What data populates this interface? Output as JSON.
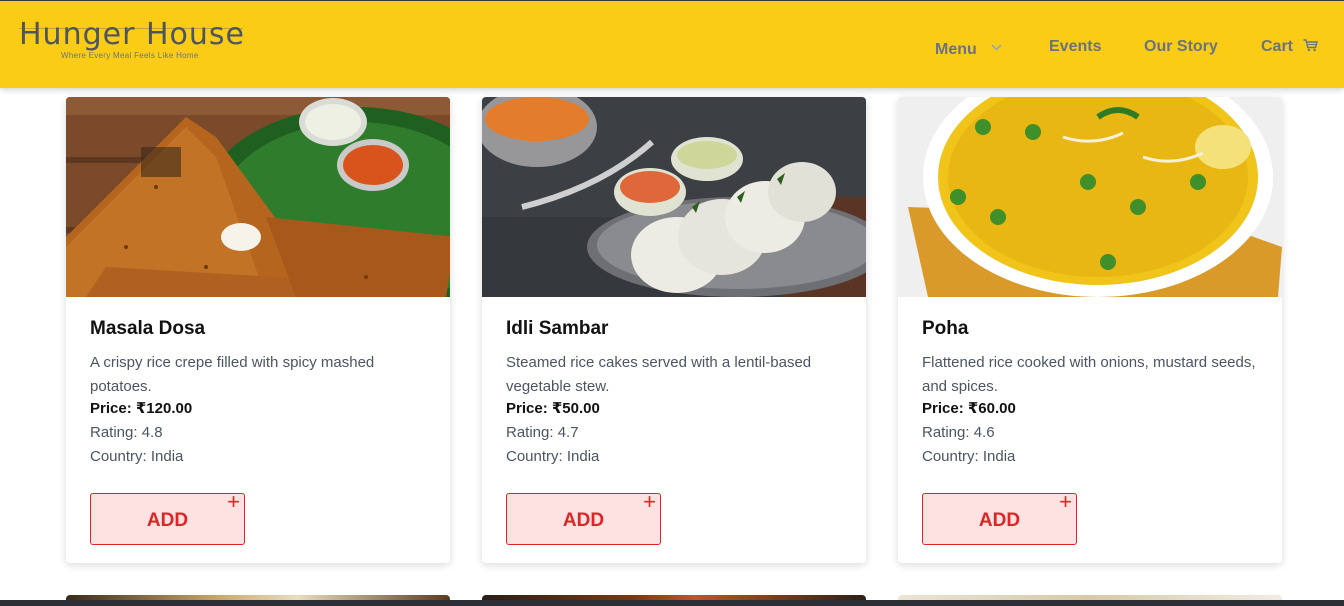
{
  "brand": {
    "name": "Hunger House",
    "tagline": "Where Every Meal Feels Like Home"
  },
  "nav": {
    "menu": "Menu",
    "events": "Events",
    "story": "Our Story",
    "cart": "Cart"
  },
  "icons": {
    "menu_chevron": "chevron-down-icon",
    "cart": "shopping-cart-icon",
    "add": "plus-icon"
  },
  "colors": {
    "navbar_bg": "#facc15",
    "nav_text": "#6b7280",
    "add_border": "#dc2626",
    "add_bg": "#fee2e2"
  },
  "items": [
    {
      "name": "Masala Dosa",
      "description": "A crispy rice crepe filled with spicy mashed potatoes.",
      "price": "Price: ₹120.00",
      "rating": "Rating: 4.8",
      "country": "Country: India",
      "button": "ADD",
      "plus": "+"
    },
    {
      "name": "Idli Sambar",
      "description": "Steamed rice cakes served with a lentil-based vegetable stew.",
      "price": "Price: ₹50.00",
      "rating": "Rating: 4.7",
      "country": "Country: India",
      "button": "ADD",
      "plus": "+"
    },
    {
      "name": "Poha",
      "description": "Flattened rice cooked with onions, mustard seeds, and spices.",
      "price": "Price: ₹60.00",
      "rating": "Rating: 4.6",
      "country": "Country: India",
      "button": "ADD",
      "plus": "+"
    }
  ]
}
